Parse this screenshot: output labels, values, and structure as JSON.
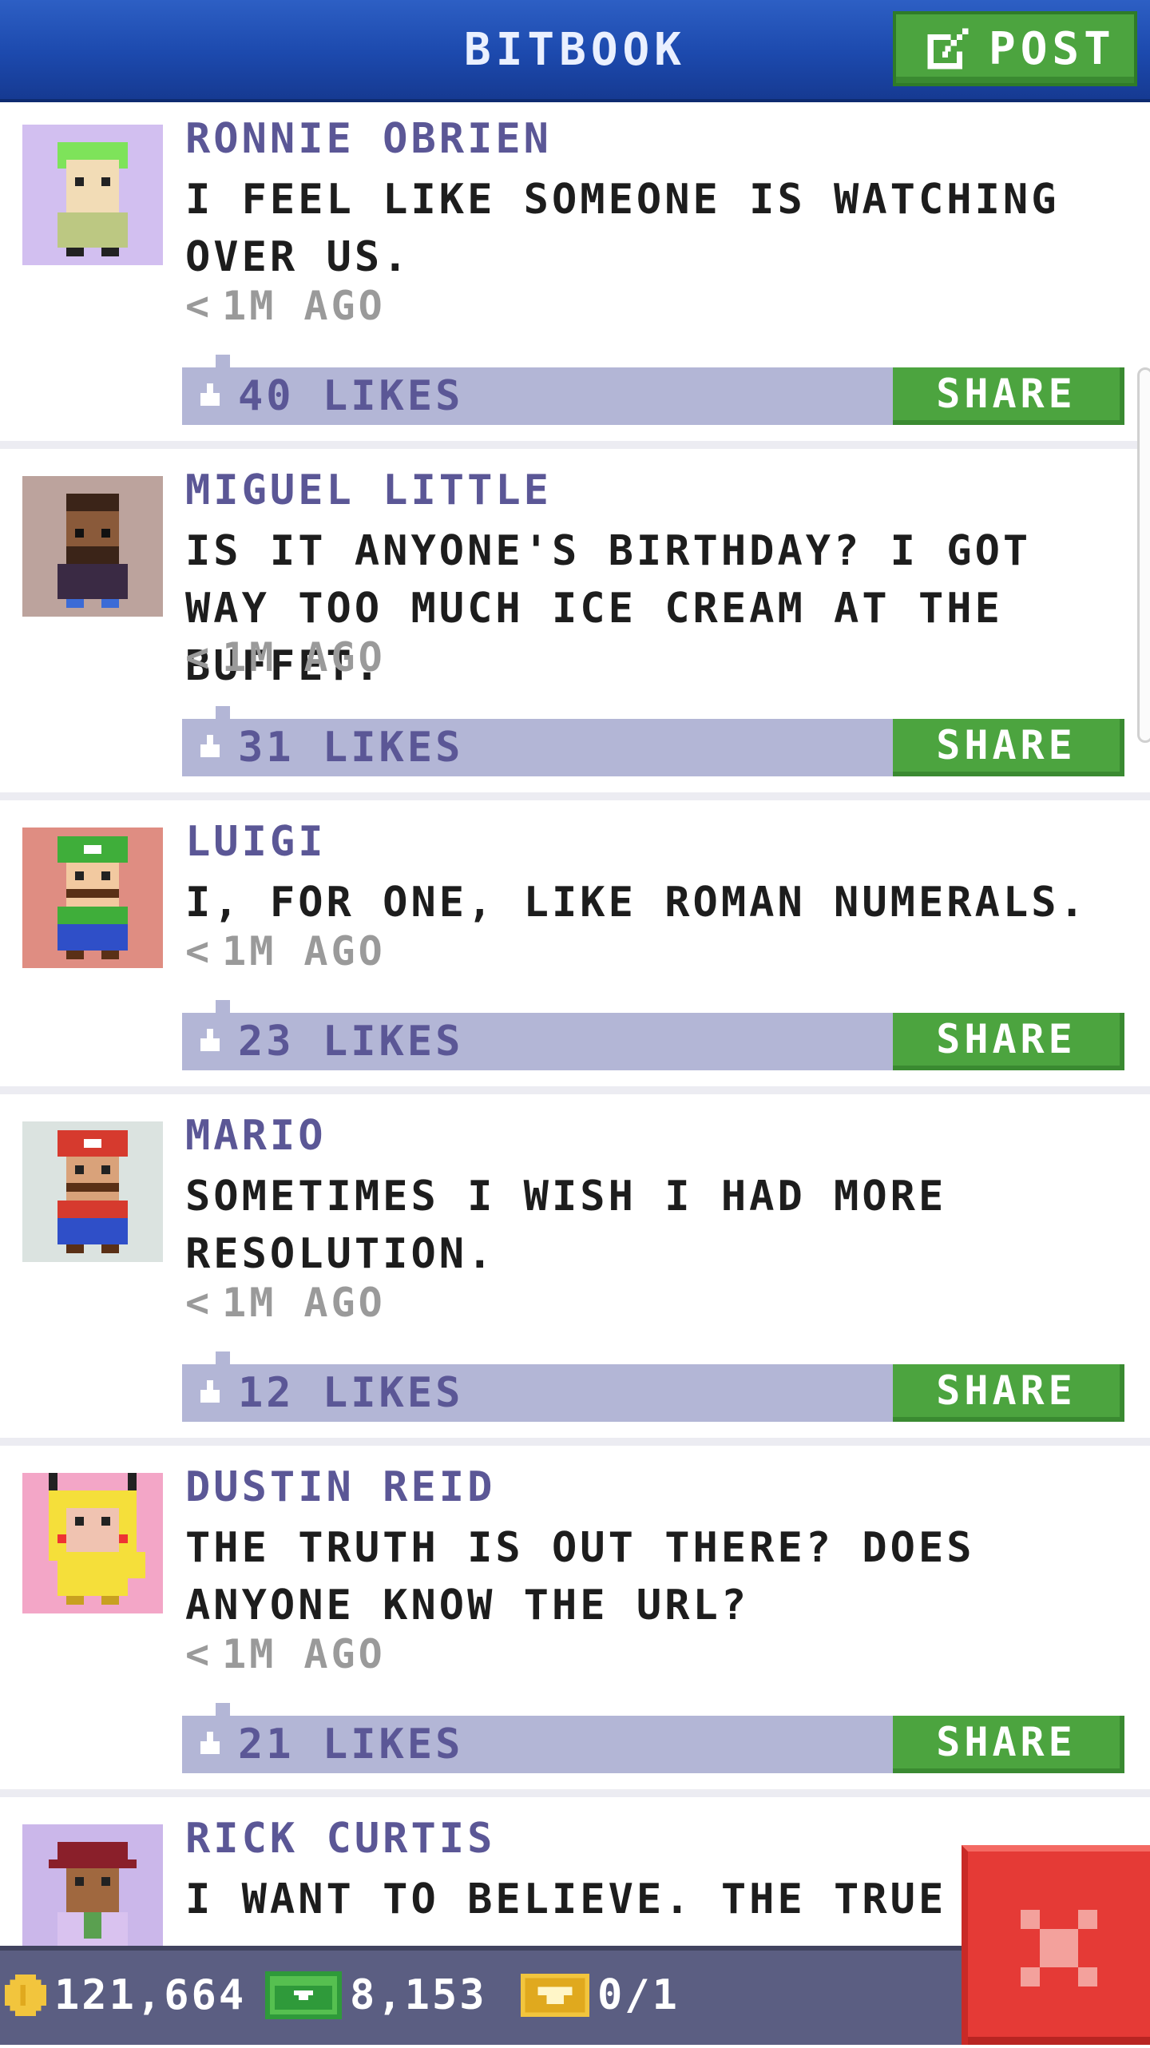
{
  "header": {
    "title": "BITBOOK",
    "post_label": "POST"
  },
  "posts": [
    {
      "author": "RONNIE OBRIEN",
      "message": "I FEEL LIKE SOMEONE IS WATCHING OVER US.",
      "time": "1M AGO",
      "likes": "40 LIKES",
      "share": "SHARE",
      "avatar_bg": "#d2bff0"
    },
    {
      "author": "MIGUEL LITTLE",
      "message": "IS IT ANYONE'S BIRTHDAY? I GOT WAY TOO MUCH ICE CREAM AT THE BUFFET.",
      "time": "1M AGO",
      "likes": "31 LIKES",
      "share": "SHARE",
      "avatar_bg": "#bca39d"
    },
    {
      "author": "LUIGI",
      "message": "I, FOR ONE, LIKE ROMAN NUMERALS.",
      "time": "1M AGO",
      "likes": "23 LIKES",
      "share": "SHARE",
      "avatar_bg": "#df8d82"
    },
    {
      "author": "MARIO",
      "message": "SOMETIMES I WISH I HAD MORE RESOLUTION.",
      "time": "1M AGO",
      "likes": "12 LIKES",
      "share": "SHARE",
      "avatar_bg": "#dbe3e0"
    },
    {
      "author": "DUSTIN REID",
      "message": "THE TRUTH IS OUT THERE? DOES ANYONE KNOW THE URL?",
      "time": "1M AGO",
      "likes": "21 LIKES",
      "share": "SHARE",
      "avatar_bg": "#f3a6c7"
    },
    {
      "author": "RICK CURTIS",
      "message": "I WANT TO BELIEVE. THE TRUE ST",
      "avatar_bg": "#cbb7ea"
    }
  ],
  "resources": {
    "coins": "121,664",
    "bux": "8,153",
    "vip": "0/1"
  },
  "colors": {
    "header_blue": "#1c49ad",
    "share_green": "#4ca43f",
    "likes_bar": "#b3b6d6",
    "author_purple": "#5b5796",
    "close_red": "#e53a36"
  }
}
